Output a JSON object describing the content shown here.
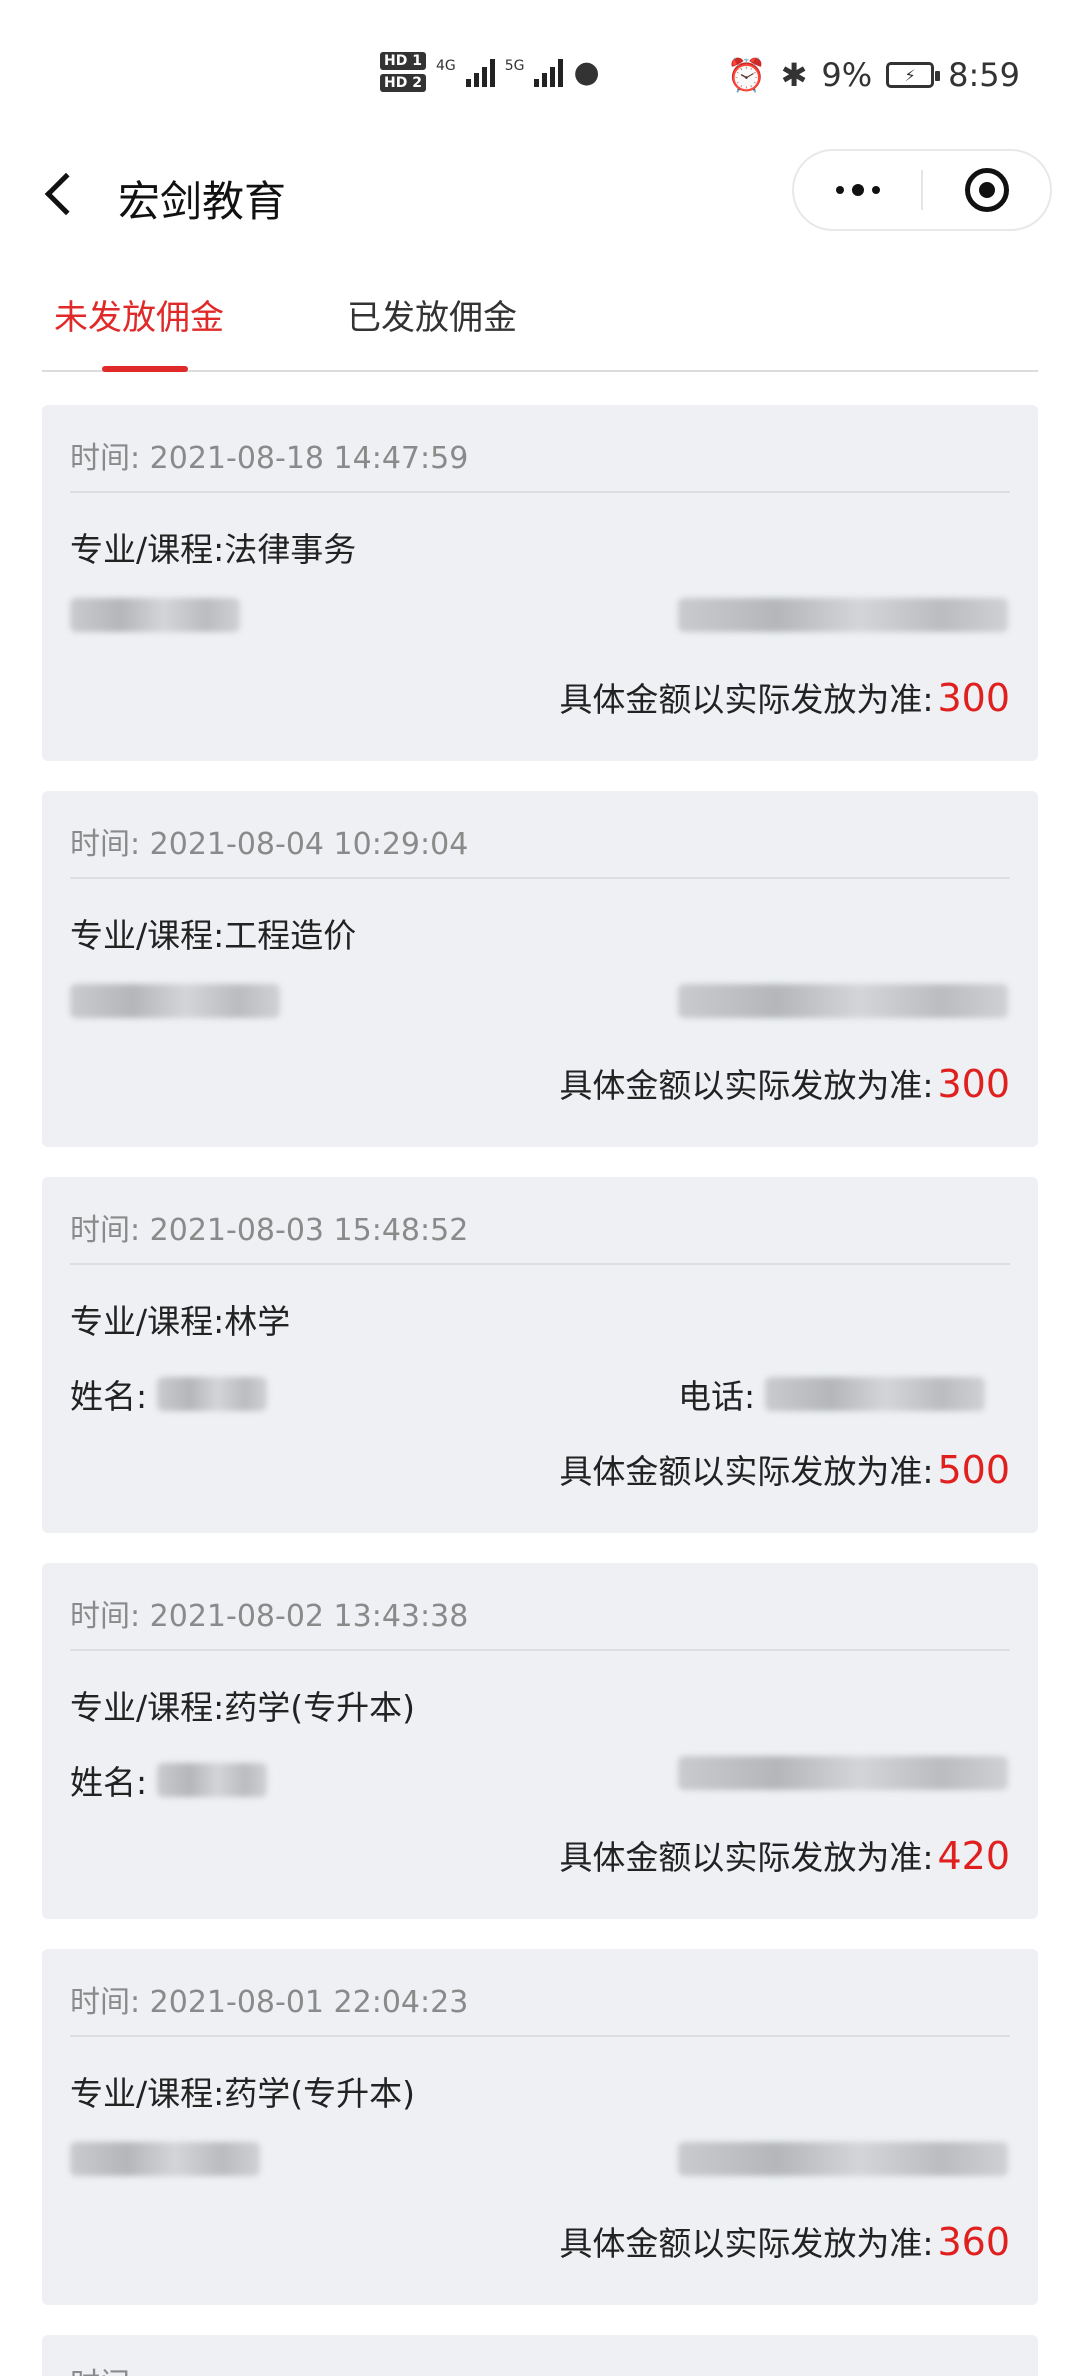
{
  "status_bar": {
    "hd1": "HD 1",
    "hd2": "HD 2",
    "net1": "4G",
    "net2": "5G",
    "battery_percent": "9%",
    "time": "8:59"
  },
  "nav": {
    "title": "宏剑教育"
  },
  "tabs": [
    {
      "label": "未发放佣金",
      "active": true
    },
    {
      "label": "已发放佣金",
      "active": false
    }
  ],
  "labels": {
    "time_prefix": "时间:",
    "course_prefix": "专业/课程:",
    "name_prefix": "姓名:",
    "phone_prefix": "电话:",
    "amount_prefix": "具体金额以实际发放为准:"
  },
  "records": [
    {
      "time": "2021-08-18 14:47:59",
      "course": "法律事务",
      "amount": "300"
    },
    {
      "time": "2021-08-04 10:29:04",
      "course": "工程造价",
      "amount": "300"
    },
    {
      "time": "2021-08-03 15:48:52",
      "course": "林学",
      "amount": "500"
    },
    {
      "time": "2021-08-02 13:43:38",
      "course": "药学(专升本)",
      "amount": "420"
    },
    {
      "time": "2021-08-01 22:04:23",
      "course": "药学(专升本)",
      "amount": "360"
    }
  ],
  "partial_card": {
    "text": "时间:"
  },
  "colors": {
    "accent": "#e02a2a",
    "card_bg": "#eef0f3",
    "amount": "#e01f1f"
  }
}
